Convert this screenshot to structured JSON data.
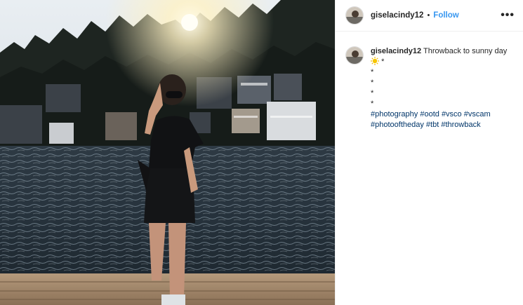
{
  "post": {
    "username": "giselacindy12",
    "separator": "•",
    "follow_label": "Follow",
    "more_icon": "more-options-icon"
  },
  "caption": {
    "username": "giselacindy12",
    "text": "Throwback to sunny day",
    "emoji": "sun-emoji",
    "after_emoji": "*",
    "star_lines": [
      "*",
      "*",
      "*",
      "*"
    ],
    "hashtags_line1": [
      "#photography",
      "#ootd",
      "#vsco",
      "#vscam"
    ],
    "hashtags_line2": [
      "#photooftheday",
      "#tbt",
      "#throwback"
    ]
  },
  "colors": {
    "follow": "#3897f0",
    "hashtag": "#003569",
    "text": "#262626"
  }
}
